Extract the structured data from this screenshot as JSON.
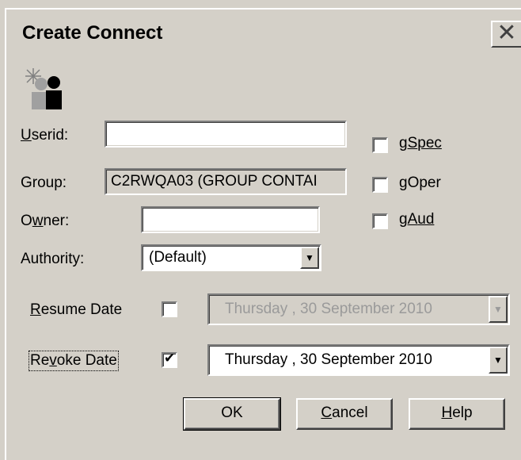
{
  "window": {
    "title": "Create Connect",
    "close_glyph": "✕"
  },
  "icons": {
    "app": "connect-users-icon",
    "close": "close-icon",
    "dropdown": "chevron-down-icon",
    "check": "checkmark-icon"
  },
  "form": {
    "userid": {
      "label_prefix": "",
      "label_access": "U",
      "label_rest": "serid:",
      "value": ""
    },
    "group": {
      "label": "Group:",
      "value": "C2RWQA03 (GROUP CONTAI"
    },
    "owner": {
      "label_prefix": "O",
      "label_access": "w",
      "label_rest": "ner:",
      "value": ""
    },
    "authority": {
      "label": "Authority:",
      "selected": "(Default)"
    },
    "gspec": {
      "label_prefix": "g",
      "label_access": "S",
      "label_rest": "pec",
      "checked": false
    },
    "goper": {
      "label": "gOper",
      "checked": false
    },
    "gaud": {
      "label_prefix": "g",
      "label_access": "A",
      "label_rest": "ud",
      "checked": false
    },
    "resume": {
      "label_prefix": "",
      "label_access": "R",
      "label_rest": "esume Date",
      "checked": false,
      "date": "Thursday  , 30 September 2010"
    },
    "revoke": {
      "label_prefix": "Re",
      "label_access": "v",
      "label_rest": "oke Date",
      "checked": true,
      "date": "Thursday  , 30 September 2010"
    }
  },
  "buttons": {
    "ok": {
      "label": "OK"
    },
    "cancel": {
      "label_access": "C",
      "label_rest": "ancel"
    },
    "help": {
      "label_access": "H",
      "label_rest": "elp"
    }
  },
  "glyphs": {
    "dropdown": "▼",
    "check": "✔"
  }
}
